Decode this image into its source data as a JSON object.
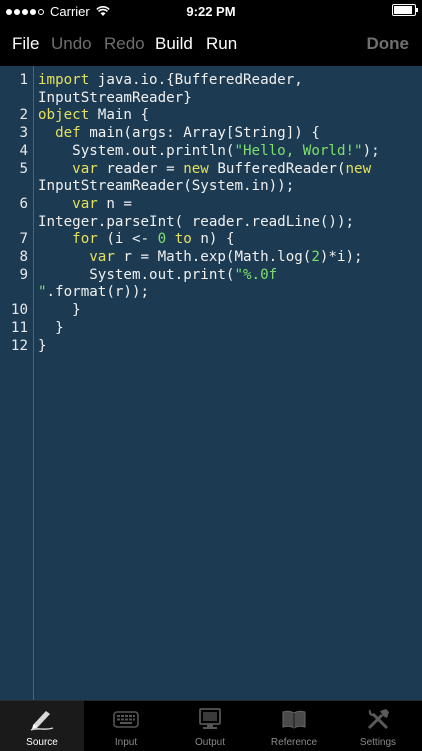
{
  "status": {
    "carrier": "Carrier",
    "time": "9:22 PM"
  },
  "toolbar": {
    "file": "File",
    "undo": "Undo",
    "redo": "Redo",
    "build": "Build",
    "run": "Run",
    "done": "Done"
  },
  "code": {
    "lines": [
      {
        "n": "1",
        "parts": [
          {
            "t": "import",
            "c": "kw"
          },
          {
            "t": " java.io.{BufferedReader,",
            "c": ""
          }
        ]
      },
      {
        "n": "",
        "parts": [
          {
            "t": "InputStreamReader}",
            "c": ""
          }
        ]
      },
      {
        "n": "2",
        "parts": [
          {
            "t": "object",
            "c": "kw"
          },
          {
            "t": " Main {",
            "c": ""
          }
        ]
      },
      {
        "n": "3",
        "parts": [
          {
            "t": "  ",
            "c": ""
          },
          {
            "t": "def",
            "c": "kw"
          },
          {
            "t": " main(args: Array[String]) {",
            "c": ""
          }
        ]
      },
      {
        "n": "4",
        "parts": [
          {
            "t": "    System.out.println(",
            "c": ""
          },
          {
            "t": "\"Hello, World!\"",
            "c": "str"
          },
          {
            "t": ");",
            "c": ""
          }
        ]
      },
      {
        "n": "5",
        "parts": [
          {
            "t": "    ",
            "c": ""
          },
          {
            "t": "var",
            "c": "kw"
          },
          {
            "t": " reader = ",
            "c": ""
          },
          {
            "t": "new",
            "c": "kw"
          },
          {
            "t": " BufferedReader(",
            "c": ""
          },
          {
            "t": "new",
            "c": "kw"
          }
        ]
      },
      {
        "n": "",
        "parts": [
          {
            "t": "InputStreamReader(System.in));",
            "c": ""
          }
        ]
      },
      {
        "n": "6",
        "parts": [
          {
            "t": "    ",
            "c": ""
          },
          {
            "t": "var",
            "c": "kw"
          },
          {
            "t": " n =",
            "c": ""
          }
        ]
      },
      {
        "n": "",
        "parts": [
          {
            "t": "Integer.parseInt( reader.readLine());",
            "c": ""
          }
        ]
      },
      {
        "n": "7",
        "parts": [
          {
            "t": "    ",
            "c": ""
          },
          {
            "t": "for",
            "c": "kw"
          },
          {
            "t": " (i <- ",
            "c": ""
          },
          {
            "t": "0",
            "c": "num"
          },
          {
            "t": " ",
            "c": ""
          },
          {
            "t": "to",
            "c": "kw"
          },
          {
            "t": " n) {",
            "c": ""
          }
        ]
      },
      {
        "n": "8",
        "parts": [
          {
            "t": "      ",
            "c": ""
          },
          {
            "t": "var",
            "c": "kw"
          },
          {
            "t": " r = Math.exp(Math.log(",
            "c": ""
          },
          {
            "t": "2",
            "c": "num"
          },
          {
            "t": ")*i);",
            "c": ""
          }
        ]
      },
      {
        "n": "9",
        "parts": [
          {
            "t": "      System.out.print(",
            "c": ""
          },
          {
            "t": "\"%.0f",
            "c": "str"
          }
        ]
      },
      {
        "n": "",
        "parts": [
          {
            "t": "\"",
            "c": "str"
          },
          {
            "t": ".format(r));",
            "c": ""
          }
        ]
      },
      {
        "n": "10",
        "parts": [
          {
            "t": "    }",
            "c": ""
          }
        ]
      },
      {
        "n": "11",
        "parts": [
          {
            "t": "  }",
            "c": ""
          }
        ]
      },
      {
        "n": "12",
        "parts": [
          {
            "t": "}",
            "c": ""
          }
        ]
      }
    ]
  },
  "tabs": [
    {
      "label": "Source",
      "icon": "pen-icon",
      "active": true
    },
    {
      "label": "Input",
      "icon": "keyboard-icon",
      "active": false
    },
    {
      "label": "Output",
      "icon": "monitor-icon",
      "active": false
    },
    {
      "label": "Reference",
      "icon": "book-icon",
      "active": false
    },
    {
      "label": "Settings",
      "icon": "tools-icon",
      "active": false
    }
  ],
  "colors": {
    "editor_bg": "#1c3a52",
    "keyword": "#e5e05a",
    "string": "#7de06a"
  }
}
